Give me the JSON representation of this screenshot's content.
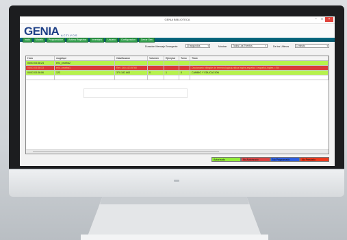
{
  "window": {
    "title": "GENIA BIBLIOTECA",
    "controls": [
      "minimize-icon",
      "maximize-icon",
      "close-icon"
    ]
  },
  "logo": {
    "text": "GENIA",
    "sub": "ACTIVOS"
  },
  "menu": [
    "Inicio",
    "Modelo",
    "Programacion",
    "Activos Registros",
    "Inventario",
    "Usuario",
    "Configuracion",
    "Cerrar Gen"
  ],
  "filters": {
    "duration_label": "Duracion Mensaje Emergente",
    "duration_value": "30 segundos",
    "show_label": "Mostrar",
    "show_value": "Todos Los Eventos",
    "period_label": "De los Ultimos",
    "period_value": "1 minuto"
  },
  "table": {
    "columns": [
      "Hora",
      "mugdiqui",
      "Clasificacion",
      "Volumen",
      "Ejemplar",
      "Tomo",
      "Titulo"
    ],
    "rows": [
      {
        "status": "green",
        "cells": [
          "04/03 03:38:24",
          "eric_prueba2",
          "",
          "",
          "",
          "",
          ""
        ]
      },
      {
        "status": "red",
        "cells": [
          "04/03 03:38:13",
          "eric_prueba1",
          "Ref. 340.413 B760",
          "",
          "",
          "",
          "Diccionario bilingüe de terminologia juridica ingles-español / español-ingles = Bil"
        ]
      },
      {
        "status": "green",
        "cells": [
          "04/03 03:38:06",
          "123",
          "370.182 A63",
          "0",
          "1",
          "0",
          "CAMBIO Y EDUCACION"
        ]
      }
    ]
  },
  "legend": [
    {
      "label": "Autorizado",
      "color": "#94ec3a"
    },
    {
      "label": "No Autorizado",
      "color": "#d94444"
    },
    {
      "label": "No Programado",
      "color": "#2f5fe0"
    },
    {
      "label": "No Prestado",
      "color": "#ee3a1e"
    }
  ]
}
